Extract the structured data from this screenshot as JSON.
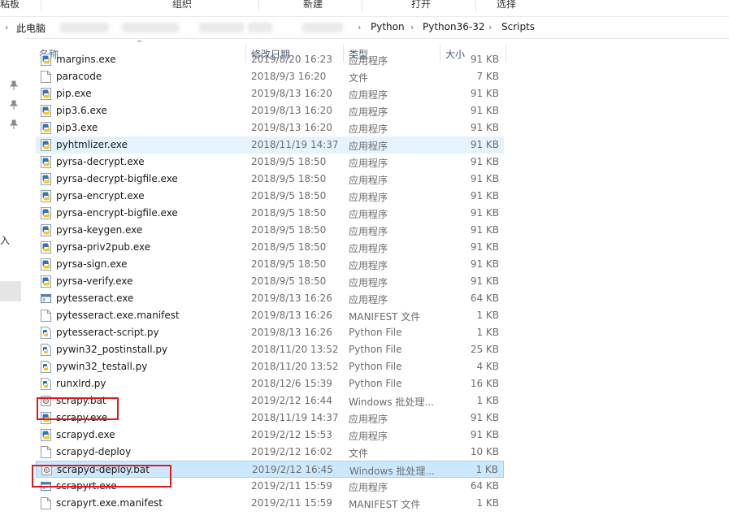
{
  "ribbon": {
    "groups": [
      "粘板",
      "组织",
      "新建",
      "打开",
      "选择"
    ]
  },
  "address": {
    "pc": "此电脑",
    "crumbs": [
      "Python",
      "Python36-32",
      "Scripts"
    ]
  },
  "nav": {
    "partial_label": "入"
  },
  "columns": {
    "name": "名称",
    "date": "修改日期",
    "type": "类型",
    "size": "大小"
  },
  "files": [
    {
      "name": "margins.exe",
      "date": "2019/8/20 16:23",
      "type": "应用程序",
      "size": "91 KB",
      "icon": "python-exe-icon"
    },
    {
      "name": "paracode",
      "date": "2018/9/3 16:20",
      "type": "文件",
      "size": "7 KB",
      "icon": "blank-file-icon"
    },
    {
      "name": "pip.exe",
      "date": "2019/8/13 16:20",
      "type": "应用程序",
      "size": "91 KB",
      "icon": "python-exe-icon"
    },
    {
      "name": "pip3.6.exe",
      "date": "2019/8/13 16:20",
      "type": "应用程序",
      "size": "91 KB",
      "icon": "python-exe-icon"
    },
    {
      "name": "pip3.exe",
      "date": "2019/8/13 16:20",
      "type": "应用程序",
      "size": "91 KB",
      "icon": "python-exe-icon"
    },
    {
      "name": "pyhtmlizer.exe",
      "date": "2018/11/19 14:37",
      "type": "应用程序",
      "size": "91 KB",
      "icon": "python-exe-icon",
      "state": "hover"
    },
    {
      "name": "pyrsa-decrypt.exe",
      "date": "2018/9/5 18:50",
      "type": "应用程序",
      "size": "91 KB",
      "icon": "python-exe-icon"
    },
    {
      "name": "pyrsa-decrypt-bigfile.exe",
      "date": "2018/9/5 18:50",
      "type": "应用程序",
      "size": "91 KB",
      "icon": "python-exe-icon"
    },
    {
      "name": "pyrsa-encrypt.exe",
      "date": "2018/9/5 18:50",
      "type": "应用程序",
      "size": "91 KB",
      "icon": "python-exe-icon"
    },
    {
      "name": "pyrsa-encrypt-bigfile.exe",
      "date": "2018/9/5 18:50",
      "type": "应用程序",
      "size": "91 KB",
      "icon": "python-exe-icon"
    },
    {
      "name": "pyrsa-keygen.exe",
      "date": "2018/9/5 18:50",
      "type": "应用程序",
      "size": "91 KB",
      "icon": "python-exe-icon"
    },
    {
      "name": "pyrsa-priv2pub.exe",
      "date": "2018/9/5 18:50",
      "type": "应用程序",
      "size": "91 KB",
      "icon": "python-exe-icon"
    },
    {
      "name": "pyrsa-sign.exe",
      "date": "2018/9/5 18:50",
      "type": "应用程序",
      "size": "91 KB",
      "icon": "python-exe-icon"
    },
    {
      "name": "pyrsa-verify.exe",
      "date": "2018/9/5 18:50",
      "type": "应用程序",
      "size": "91 KB",
      "icon": "python-exe-icon"
    },
    {
      "name": "pytesseract.exe",
      "date": "2019/8/13 16:26",
      "type": "应用程序",
      "size": "64 KB",
      "icon": "window-exe-icon"
    },
    {
      "name": "pytesseract.exe.manifest",
      "date": "2019/8/13 16:26",
      "type": "MANIFEST 文件",
      "size": "1 KB",
      "icon": "blank-file-icon"
    },
    {
      "name": "pytesseract-script.py",
      "date": "2019/8/13 16:26",
      "type": "Python File",
      "size": "1 KB",
      "icon": "python-file-icon"
    },
    {
      "name": "pywin32_postinstall.py",
      "date": "2018/11/20 13:52",
      "type": "Python File",
      "size": "25 KB",
      "icon": "python-file-icon"
    },
    {
      "name": "pywin32_testall.py",
      "date": "2018/11/20 13:52",
      "type": "Python File",
      "size": "4 KB",
      "icon": "python-file-icon"
    },
    {
      "name": "runxlrd.py",
      "date": "2018/12/6 15:39",
      "type": "Python File",
      "size": "16 KB",
      "icon": "python-file-icon"
    },
    {
      "name": "scrapy.bat",
      "date": "2019/2/12 16:44",
      "type": "Windows 批处理...",
      "size": "1 KB",
      "icon": "batch-file-icon"
    },
    {
      "name": "scrapy.exe",
      "date": "2018/11/19 14:37",
      "type": "应用程序",
      "size": "91 KB",
      "icon": "python-exe-icon"
    },
    {
      "name": "scrapyd.exe",
      "date": "2019/2/12 15:53",
      "type": "应用程序",
      "size": "91 KB",
      "icon": "python-exe-icon"
    },
    {
      "name": "scrapyd-deploy",
      "date": "2019/2/12 16:02",
      "type": "文件",
      "size": "10 KB",
      "icon": "blank-file-icon"
    },
    {
      "name": "scrapyd-deploy.bat",
      "date": "2019/2/12 16:45",
      "type": "Windows 批处理...",
      "size": "1 KB",
      "icon": "batch-file-icon",
      "state": "selected"
    },
    {
      "name": "scrapyrt.exe",
      "date": "2019/2/11 15:59",
      "type": "应用程序",
      "size": "64 KB",
      "icon": "window-exe-icon"
    },
    {
      "name": "scrapyrt.exe.manifest",
      "date": "2019/2/11 15:59",
      "type": "MANIFEST 文件",
      "size": "1 KB",
      "icon": "blank-file-icon"
    }
  ],
  "highlight_color": "#e0191b",
  "selection_color": "#cce8ff"
}
